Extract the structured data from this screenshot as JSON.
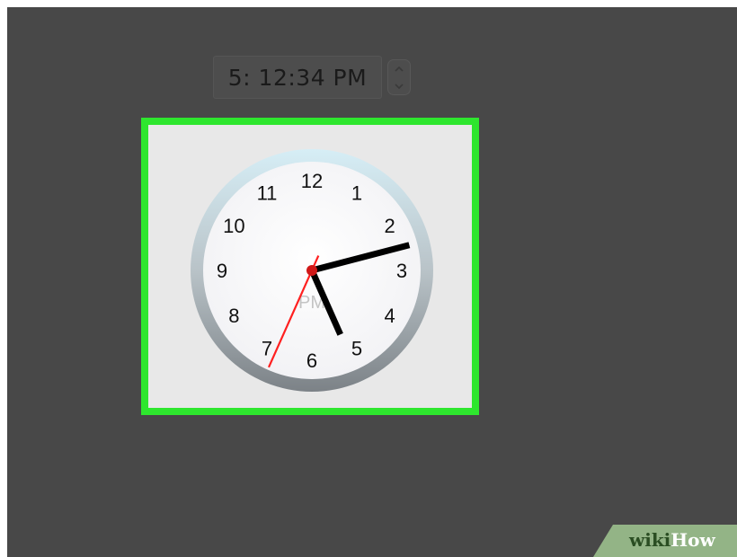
{
  "time_picker": {
    "value": "5: 12:34 PM",
    "stepper_up_icon": "chevron-up-icon",
    "stepper_down_icon": "chevron-down-icon"
  },
  "clock": {
    "numerals": [
      "12",
      "1",
      "2",
      "3",
      "4",
      "5",
      "6",
      "7",
      "8",
      "9",
      "10",
      "11"
    ],
    "period": "PM",
    "time": {
      "hours": 5,
      "minutes": 12,
      "seconds": 34
    },
    "highlight_color": "#2ee62e",
    "second_hand_color": "#ff2020"
  },
  "watermark": {
    "wiki": "wiki",
    "how": "How"
  }
}
